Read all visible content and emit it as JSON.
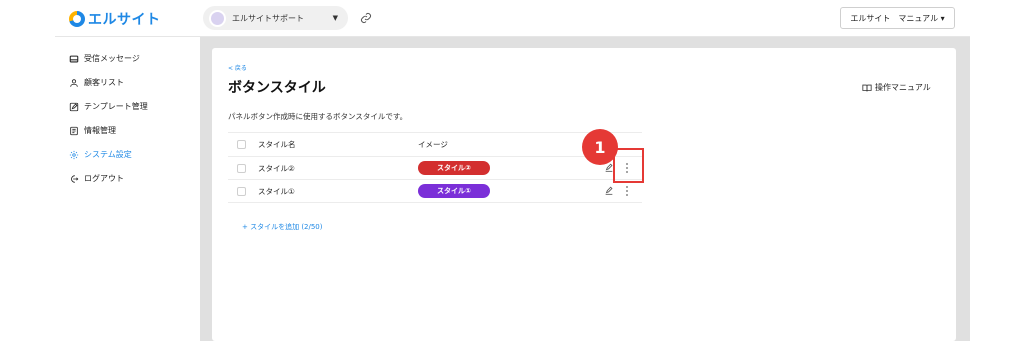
{
  "header": {
    "logo_text": "エルサイト",
    "account_name": "エルサイトサポート",
    "manual_label": "エルサイト　マニュアル ▾"
  },
  "sidebar": {
    "items": [
      {
        "label": "受信メッセージ",
        "icon": "inbox-icon"
      },
      {
        "label": "顧客リスト",
        "icon": "user-icon"
      },
      {
        "label": "テンプレート管理",
        "icon": "edit-icon"
      },
      {
        "label": "情報管理",
        "icon": "document-icon"
      },
      {
        "label": "システム設定",
        "icon": "gear-icon",
        "active": true
      },
      {
        "label": "ログアウト",
        "icon": "logout-icon"
      }
    ]
  },
  "main": {
    "back_label": "< 戻る",
    "title": "ボタンスタイル",
    "operation_manual": "操作マニュアル",
    "description": "パネルボタン作成時に使用するボタンスタイルです。",
    "table": {
      "headers": [
        "スタイル名",
        "イメージ"
      ],
      "rows": [
        {
          "name": "スタイル②",
          "pill_label": "スタイル②",
          "pill_color": "#d32f2f"
        },
        {
          "name": "スタイル①",
          "pill_label": "スタイル①",
          "pill_color": "#7b2fd8"
        }
      ]
    },
    "add_link": "+ スタイルを追加 (2/50)"
  },
  "annotation": {
    "step_number": "1",
    "color": "#e53935"
  }
}
